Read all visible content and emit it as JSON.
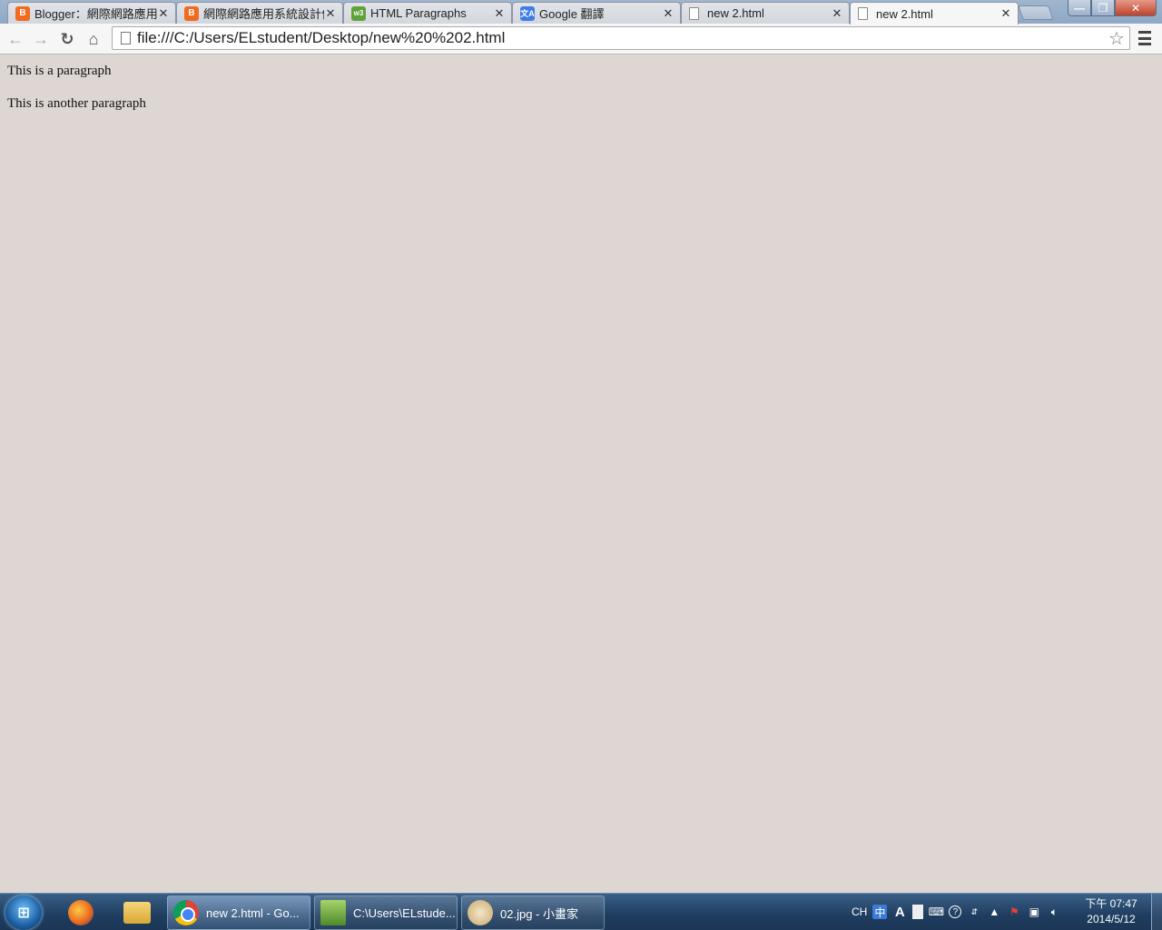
{
  "browser": {
    "tabs": [
      {
        "title": "Blogger：網際網路應用",
        "favicon": "blogger-icon"
      },
      {
        "title": "網際網路應用系統設計作",
        "favicon": "blogger-icon"
      },
      {
        "title": "HTML Paragraphs",
        "favicon": "w3schools-icon"
      },
      {
        "title": "Google 翻譯",
        "favicon": "google-translate-icon"
      },
      {
        "title": "new  2.html",
        "favicon": "document-icon"
      },
      {
        "title": "new  2.html",
        "favicon": "document-icon",
        "active": true
      }
    ],
    "address_bar": {
      "url": "file:///C:/Users/ELstudent/Desktop/new%20%202.html"
    }
  },
  "page": {
    "paragraphs": [
      "This is a paragraph",
      "This is another paragraph"
    ]
  },
  "taskbar": {
    "pinned": [
      "firefox-icon",
      "explorer-folder-icon"
    ],
    "windows": [
      {
        "label": "new  2.html - Go...",
        "icon": "chrome-icon",
        "active": true
      },
      {
        "label": "C:\\Users\\ELstude...",
        "icon": "notepad-icon"
      },
      {
        "label": "02.jpg - 小畫家",
        "icon": "paint-icon"
      }
    ],
    "tray": {
      "language": "CH",
      "time": "下午 07:47",
      "date": "2014/5/12"
    }
  },
  "colors": {
    "page_background": "#ddd6d2",
    "taskbar": "#1f3d60",
    "tab_strip": "#9fb6cf"
  }
}
